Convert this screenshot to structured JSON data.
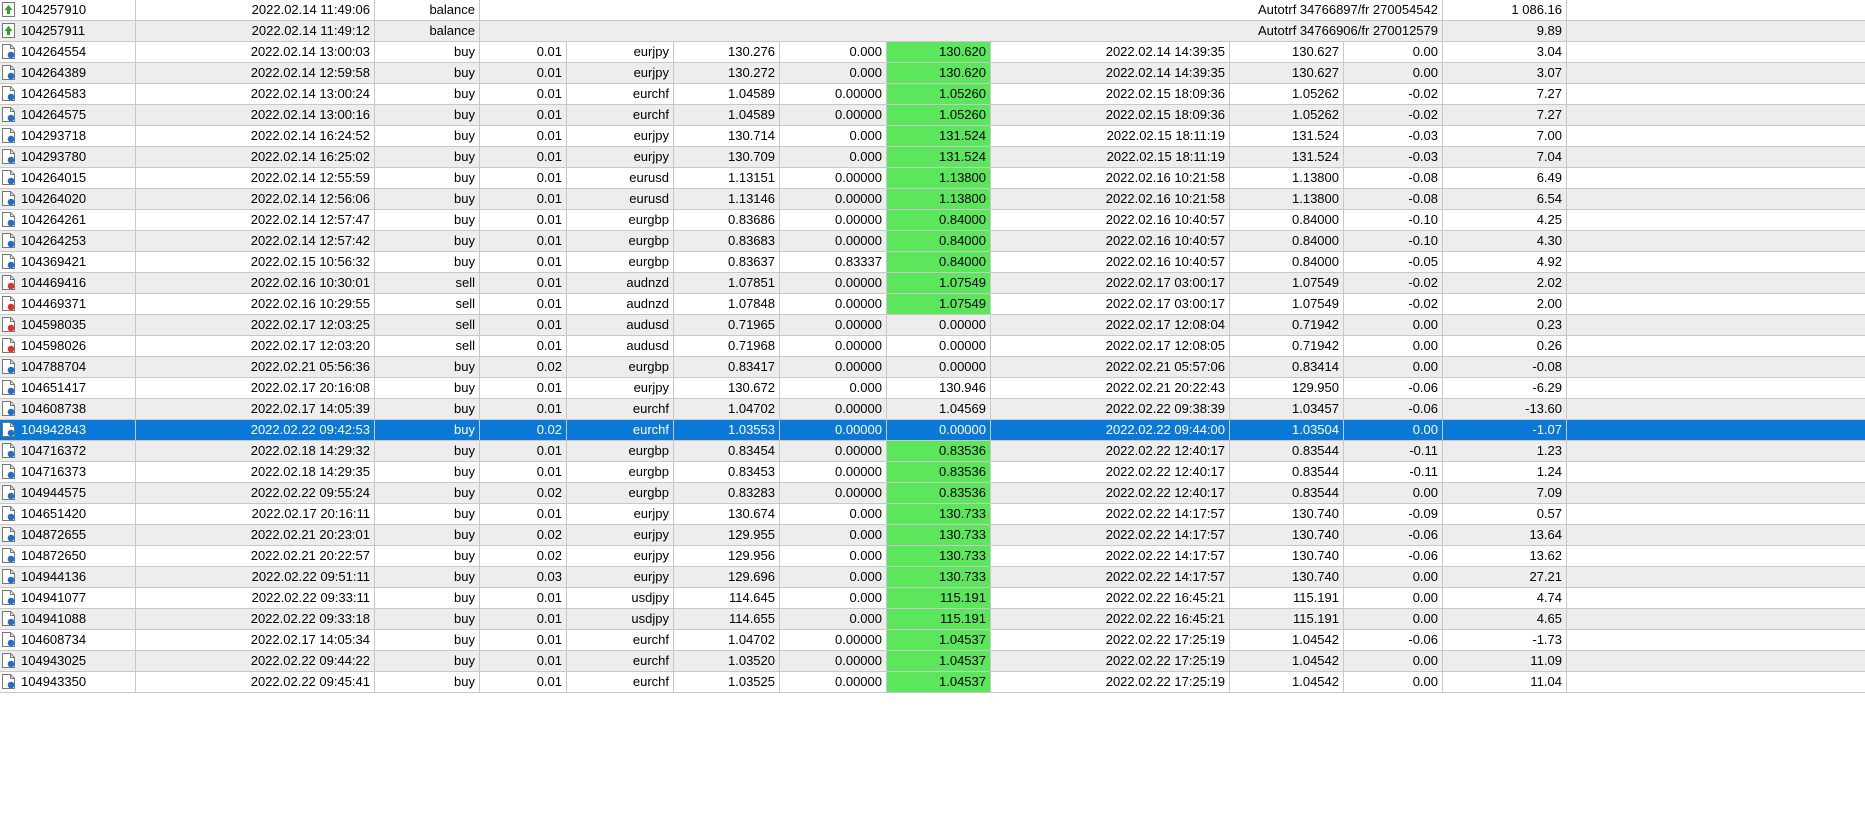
{
  "columns": [
    "ticket",
    "open_time",
    "type",
    "size",
    "symbol",
    "open_price",
    "sl",
    "tp",
    "close_time",
    "close_price",
    "commission",
    "profit"
  ],
  "colors": {
    "tp_highlight": "#5ce65c",
    "selected_row": "#0a78d7",
    "buy_icon_dot": "#1f6fd1",
    "sell_icon_dot": "#d9352b",
    "balance_icon": "#2aa52a"
  },
  "rows": [
    {
      "ticket": "104257910",
      "open_time": "2022.02.14 11:49:06",
      "type": "balance",
      "comment": "Autotrf 34766897/fr 270054542",
      "profit": "1 086.16",
      "icon": "balance-icon"
    },
    {
      "ticket": "104257911",
      "open_time": "2022.02.14 11:49:12",
      "type": "balance",
      "comment": "Autotrf 34766906/fr 270012579",
      "profit": "9.89",
      "icon": "balance-icon"
    },
    {
      "ticket": "104264554",
      "open_time": "2022.02.14 13:00:03",
      "type": "buy",
      "size": "0.01",
      "symbol": "eurjpy",
      "open_price": "130.276",
      "sl": "0.000",
      "tp": "130.620",
      "tp_hit": true,
      "close_time": "2022.02.14 14:39:35",
      "close_price": "130.627",
      "commission": "0.00",
      "profit": "3.04",
      "icon": "buy-icon"
    },
    {
      "ticket": "104264389",
      "open_time": "2022.02.14 12:59:58",
      "type": "buy",
      "size": "0.01",
      "symbol": "eurjpy",
      "open_price": "130.272",
      "sl": "0.000",
      "tp": "130.620",
      "tp_hit": true,
      "close_time": "2022.02.14 14:39:35",
      "close_price": "130.627",
      "commission": "0.00",
      "profit": "3.07",
      "icon": "buy-icon"
    },
    {
      "ticket": "104264583",
      "open_time": "2022.02.14 13:00:24",
      "type": "buy",
      "size": "0.01",
      "symbol": "eurchf",
      "open_price": "1.04589",
      "sl": "0.00000",
      "tp": "1.05260",
      "tp_hit": true,
      "close_time": "2022.02.15 18:09:36",
      "close_price": "1.05262",
      "commission": "-0.02",
      "profit": "7.27",
      "icon": "buy-icon"
    },
    {
      "ticket": "104264575",
      "open_time": "2022.02.14 13:00:16",
      "type": "buy",
      "size": "0.01",
      "symbol": "eurchf",
      "open_price": "1.04589",
      "sl": "0.00000",
      "tp": "1.05260",
      "tp_hit": true,
      "close_time": "2022.02.15 18:09:36",
      "close_price": "1.05262",
      "commission": "-0.02",
      "profit": "7.27",
      "icon": "buy-icon"
    },
    {
      "ticket": "104293718",
      "open_time": "2022.02.14 16:24:52",
      "type": "buy",
      "size": "0.01",
      "symbol": "eurjpy",
      "open_price": "130.714",
      "sl": "0.000",
      "tp": "131.524",
      "tp_hit": true,
      "close_time": "2022.02.15 18:11:19",
      "close_price": "131.524",
      "commission": "-0.03",
      "profit": "7.00",
      "icon": "buy-icon"
    },
    {
      "ticket": "104293780",
      "open_time": "2022.02.14 16:25:02",
      "type": "buy",
      "size": "0.01",
      "symbol": "eurjpy",
      "open_price": "130.709",
      "sl": "0.000",
      "tp": "131.524",
      "tp_hit": true,
      "close_time": "2022.02.15 18:11:19",
      "close_price": "131.524",
      "commission": "-0.03",
      "profit": "7.04",
      "icon": "buy-icon"
    },
    {
      "ticket": "104264015",
      "open_time": "2022.02.14 12:55:59",
      "type": "buy",
      "size": "0.01",
      "symbol": "eurusd",
      "open_price": "1.13151",
      "sl": "0.00000",
      "tp": "1.13800",
      "tp_hit": true,
      "close_time": "2022.02.16 10:21:58",
      "close_price": "1.13800",
      "commission": "-0.08",
      "profit": "6.49",
      "icon": "buy-icon"
    },
    {
      "ticket": "104264020",
      "open_time": "2022.02.14 12:56:06",
      "type": "buy",
      "size": "0.01",
      "symbol": "eurusd",
      "open_price": "1.13146",
      "sl": "0.00000",
      "tp": "1.13800",
      "tp_hit": true,
      "close_time": "2022.02.16 10:21:58",
      "close_price": "1.13800",
      "commission": "-0.08",
      "profit": "6.54",
      "icon": "buy-icon"
    },
    {
      "ticket": "104264261",
      "open_time": "2022.02.14 12:57:47",
      "type": "buy",
      "size": "0.01",
      "symbol": "eurgbp",
      "open_price": "0.83686",
      "sl": "0.00000",
      "tp": "0.84000",
      "tp_hit": true,
      "close_time": "2022.02.16 10:40:57",
      "close_price": "0.84000",
      "commission": "-0.10",
      "profit": "4.25",
      "icon": "buy-icon"
    },
    {
      "ticket": "104264253",
      "open_time": "2022.02.14 12:57:42",
      "type": "buy",
      "size": "0.01",
      "symbol": "eurgbp",
      "open_price": "0.83683",
      "sl": "0.00000",
      "tp": "0.84000",
      "tp_hit": true,
      "close_time": "2022.02.16 10:40:57",
      "close_price": "0.84000",
      "commission": "-0.10",
      "profit": "4.30",
      "icon": "buy-icon"
    },
    {
      "ticket": "104369421",
      "open_time": "2022.02.15 10:56:32",
      "type": "buy",
      "size": "0.01",
      "symbol": "eurgbp",
      "open_price": "0.83637",
      "sl": "0.83337",
      "tp": "0.84000",
      "tp_hit": true,
      "close_time": "2022.02.16 10:40:57",
      "close_price": "0.84000",
      "commission": "-0.05",
      "profit": "4.92",
      "icon": "buy-icon"
    },
    {
      "ticket": "104469416",
      "open_time": "2022.02.16 10:30:01",
      "type": "sell",
      "size": "0.01",
      "symbol": "audnzd",
      "open_price": "1.07851",
      "sl": "0.00000",
      "tp": "1.07549",
      "tp_hit": true,
      "close_time": "2022.02.17 03:00:17",
      "close_price": "1.07549",
      "commission": "-0.02",
      "profit": "2.02",
      "icon": "sell-icon"
    },
    {
      "ticket": "104469371",
      "open_time": "2022.02.16 10:29:55",
      "type": "sell",
      "size": "0.01",
      "symbol": "audnzd",
      "open_price": "1.07848",
      "sl": "0.00000",
      "tp": "1.07549",
      "tp_hit": true,
      "close_time": "2022.02.17 03:00:17",
      "close_price": "1.07549",
      "commission": "-0.02",
      "profit": "2.00",
      "icon": "sell-icon"
    },
    {
      "ticket": "104598035",
      "open_time": "2022.02.17 12:03:25",
      "type": "sell",
      "size": "0.01",
      "symbol": "audusd",
      "open_price": "0.71965",
      "sl": "0.00000",
      "tp": "0.00000",
      "tp_hit": false,
      "close_time": "2022.02.17 12:08:04",
      "close_price": "0.71942",
      "commission": "0.00",
      "profit": "0.23",
      "icon": "sell-icon"
    },
    {
      "ticket": "104598026",
      "open_time": "2022.02.17 12:03:20",
      "type": "sell",
      "size": "0.01",
      "symbol": "audusd",
      "open_price": "0.71968",
      "sl": "0.00000",
      "tp": "0.00000",
      "tp_hit": false,
      "close_time": "2022.02.17 12:08:05",
      "close_price": "0.71942",
      "commission": "0.00",
      "profit": "0.26",
      "icon": "sell-icon"
    },
    {
      "ticket": "104788704",
      "open_time": "2022.02.21 05:56:36",
      "type": "buy",
      "size": "0.02",
      "symbol": "eurgbp",
      "open_price": "0.83417",
      "sl": "0.00000",
      "tp": "0.00000",
      "tp_hit": false,
      "close_time": "2022.02.21 05:57:06",
      "close_price": "0.83414",
      "commission": "0.00",
      "profit": "-0.08",
      "icon": "buy-icon"
    },
    {
      "ticket": "104651417",
      "open_time": "2022.02.17 20:16:08",
      "type": "buy",
      "size": "0.01",
      "symbol": "eurjpy",
      "open_price": "130.672",
      "sl": "0.000",
      "tp": "130.946",
      "tp_hit": false,
      "close_time": "2022.02.21 20:22:43",
      "close_price": "129.950",
      "commission": "-0.06",
      "profit": "-6.29",
      "icon": "buy-icon"
    },
    {
      "ticket": "104608738",
      "open_time": "2022.02.17 14:05:39",
      "type": "buy",
      "size": "0.01",
      "symbol": "eurchf",
      "open_price": "1.04702",
      "sl": "0.00000",
      "tp": "1.04569",
      "tp_hit": false,
      "close_time": "2022.02.22 09:38:39",
      "close_price": "1.03457",
      "commission": "-0.06",
      "profit": "-13.60",
      "icon": "buy-icon"
    },
    {
      "ticket": "104942843",
      "open_time": "2022.02.22 09:42:53",
      "type": "buy",
      "size": "0.02",
      "symbol": "eurchf",
      "open_price": "1.03553",
      "sl": "0.00000",
      "tp": "0.00000",
      "tp_hit": false,
      "close_time": "2022.02.22 09:44:00",
      "close_price": "1.03504",
      "commission": "0.00",
      "profit": "-1.07",
      "icon": "buy-icon",
      "selected": true
    },
    {
      "ticket": "104716372",
      "open_time": "2022.02.18 14:29:32",
      "type": "buy",
      "size": "0.01",
      "symbol": "eurgbp",
      "open_price": "0.83454",
      "sl": "0.00000",
      "tp": "0.83536",
      "tp_hit": true,
      "close_time": "2022.02.22 12:40:17",
      "close_price": "0.83544",
      "commission": "-0.11",
      "profit": "1.23",
      "icon": "buy-icon"
    },
    {
      "ticket": "104716373",
      "open_time": "2022.02.18 14:29:35",
      "type": "buy",
      "size": "0.01",
      "symbol": "eurgbp",
      "open_price": "0.83453",
      "sl": "0.00000",
      "tp": "0.83536",
      "tp_hit": true,
      "close_time": "2022.02.22 12:40:17",
      "close_price": "0.83544",
      "commission": "-0.11",
      "profit": "1.24",
      "icon": "buy-icon"
    },
    {
      "ticket": "104944575",
      "open_time": "2022.02.22 09:55:24",
      "type": "buy",
      "size": "0.02",
      "symbol": "eurgbp",
      "open_price": "0.83283",
      "sl": "0.00000",
      "tp": "0.83536",
      "tp_hit": true,
      "close_time": "2022.02.22 12:40:17",
      "close_price": "0.83544",
      "commission": "0.00",
      "profit": "7.09",
      "icon": "buy-icon"
    },
    {
      "ticket": "104651420",
      "open_time": "2022.02.17 20:16:11",
      "type": "buy",
      "size": "0.01",
      "symbol": "eurjpy",
      "open_price": "130.674",
      "sl": "0.000",
      "tp": "130.733",
      "tp_hit": true,
      "close_time": "2022.02.22 14:17:57",
      "close_price": "130.740",
      "commission": "-0.09",
      "profit": "0.57",
      "icon": "buy-icon"
    },
    {
      "ticket": "104872655",
      "open_time": "2022.02.21 20:23:01",
      "type": "buy",
      "size": "0.02",
      "symbol": "eurjpy",
      "open_price": "129.955",
      "sl": "0.000",
      "tp": "130.733",
      "tp_hit": true,
      "close_time": "2022.02.22 14:17:57",
      "close_price": "130.740",
      "commission": "-0.06",
      "profit": "13.64",
      "icon": "buy-icon"
    },
    {
      "ticket": "104872650",
      "open_time": "2022.02.21 20:22:57",
      "type": "buy",
      "size": "0.02",
      "symbol": "eurjpy",
      "open_price": "129.956",
      "sl": "0.000",
      "tp": "130.733",
      "tp_hit": true,
      "close_time": "2022.02.22 14:17:57",
      "close_price": "130.740",
      "commission": "-0.06",
      "profit": "13.62",
      "icon": "buy-icon"
    },
    {
      "ticket": "104944136",
      "open_time": "2022.02.22 09:51:11",
      "type": "buy",
      "size": "0.03",
      "symbol": "eurjpy",
      "open_price": "129.696",
      "sl": "0.000",
      "tp": "130.733",
      "tp_hit": true,
      "close_time": "2022.02.22 14:17:57",
      "close_price": "130.740",
      "commission": "0.00",
      "profit": "27.21",
      "icon": "buy-icon"
    },
    {
      "ticket": "104941077",
      "open_time": "2022.02.22 09:33:11",
      "type": "buy",
      "size": "0.01",
      "symbol": "usdjpy",
      "open_price": "114.645",
      "sl": "0.000",
      "tp": "115.191",
      "tp_hit": true,
      "close_time": "2022.02.22 16:45:21",
      "close_price": "115.191",
      "commission": "0.00",
      "profit": "4.74",
      "icon": "buy-icon"
    },
    {
      "ticket": "104941088",
      "open_time": "2022.02.22 09:33:18",
      "type": "buy",
      "size": "0.01",
      "symbol": "usdjpy",
      "open_price": "114.655",
      "sl": "0.000",
      "tp": "115.191",
      "tp_hit": true,
      "close_time": "2022.02.22 16:45:21",
      "close_price": "115.191",
      "commission": "0.00",
      "profit": "4.65",
      "icon": "buy-icon"
    },
    {
      "ticket": "104608734",
      "open_time": "2022.02.17 14:05:34",
      "type": "buy",
      "size": "0.01",
      "symbol": "eurchf",
      "open_price": "1.04702",
      "sl": "0.00000",
      "tp": "1.04537",
      "tp_hit": true,
      "close_time": "2022.02.22 17:25:19",
      "close_price": "1.04542",
      "commission": "-0.06",
      "profit": "-1.73",
      "icon": "buy-icon"
    },
    {
      "ticket": "104943025",
      "open_time": "2022.02.22 09:44:22",
      "type": "buy",
      "size": "0.01",
      "symbol": "eurchf",
      "open_price": "1.03520",
      "sl": "0.00000",
      "tp": "1.04537",
      "tp_hit": true,
      "close_time": "2022.02.22 17:25:19",
      "close_price": "1.04542",
      "commission": "0.00",
      "profit": "11.09",
      "icon": "buy-icon"
    },
    {
      "ticket": "104943350",
      "open_time": "2022.02.22 09:45:41",
      "type": "buy",
      "size": "0.01",
      "symbol": "eurchf",
      "open_price": "1.03525",
      "sl": "0.00000",
      "tp": "1.04537",
      "tp_hit": true,
      "close_time": "2022.02.22 17:25:19",
      "close_price": "1.04542",
      "commission": "0.00",
      "profit": "11.04",
      "icon": "buy-icon"
    }
  ]
}
